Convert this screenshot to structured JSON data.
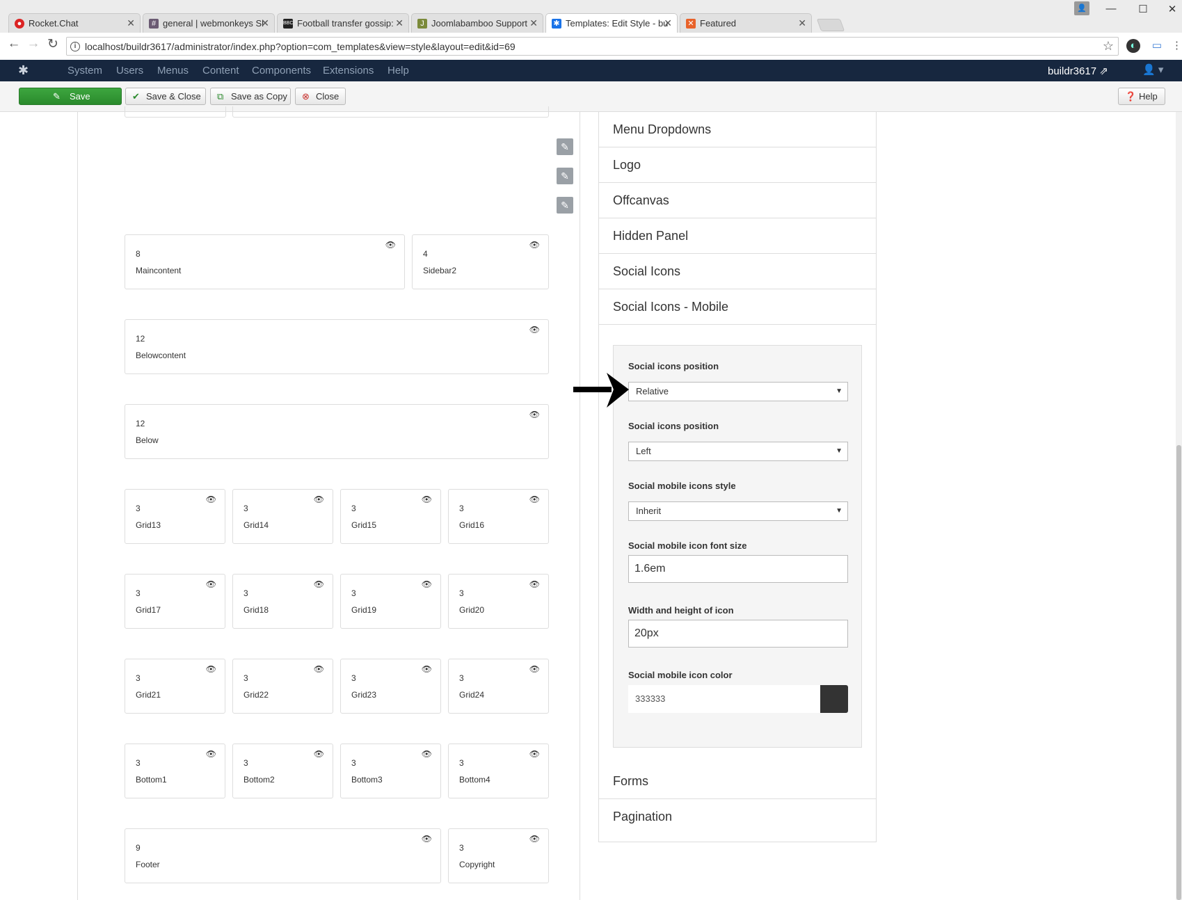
{
  "browser": {
    "tabs": [
      {
        "title": "Rocket.Chat",
        "fav": "rocketchat-icon",
        "color": "#db2323"
      },
      {
        "title": "general | webmonkeys Sl",
        "fav": "slack-hash-icon",
        "color": "#6b5b73"
      },
      {
        "title": "Football transfer gossip:",
        "fav": "bbc-icon",
        "color": "#222222"
      },
      {
        "title": "Joomlabamboo Support",
        "fav": "joomlabamboo-icon",
        "color": "#7b8a3a"
      },
      {
        "title": "Templates: Edit Style - bu",
        "fav": "joomla-icon",
        "color": "#1a73e8"
      },
      {
        "title": "Featured",
        "fav": "featured-icon",
        "color": "#e8622a"
      }
    ],
    "url": "localhost/buildr3617/administrator/index.php?option=com_templates&view=style&layout=edit&id=69"
  },
  "joomla": {
    "menu": [
      "System",
      "Users",
      "Menus",
      "Content",
      "Components",
      "Extensions",
      "Help"
    ],
    "site": "buildr3617",
    "toolbar": {
      "save": "Save",
      "save_close": "Save & Close",
      "save_copy": "Save as Copy",
      "close": "Close",
      "help": "Help"
    }
  },
  "layout_rows": [
    [
      {
        "n": "8",
        "name": "Maincontent"
      },
      {
        "n": "4",
        "name": "Sidebar2"
      }
    ],
    [
      {
        "n": "12",
        "name": "Belowcontent"
      }
    ],
    [
      {
        "n": "12",
        "name": "Below"
      }
    ],
    [
      {
        "n": "3",
        "name": "Grid13"
      },
      {
        "n": "3",
        "name": "Grid14"
      },
      {
        "n": "3",
        "name": "Grid15"
      },
      {
        "n": "3",
        "name": "Grid16"
      }
    ],
    [
      {
        "n": "3",
        "name": "Grid17"
      },
      {
        "n": "3",
        "name": "Grid18"
      },
      {
        "n": "3",
        "name": "Grid19"
      },
      {
        "n": "3",
        "name": "Grid20"
      }
    ],
    [
      {
        "n": "3",
        "name": "Grid21"
      },
      {
        "n": "3",
        "name": "Grid22"
      },
      {
        "n": "3",
        "name": "Grid23"
      },
      {
        "n": "3",
        "name": "Grid24"
      }
    ],
    [
      {
        "n": "3",
        "name": "Bottom1"
      },
      {
        "n": "3",
        "name": "Bottom2"
      },
      {
        "n": "3",
        "name": "Bottom3"
      },
      {
        "n": "3",
        "name": "Bottom4"
      }
    ],
    [
      {
        "n": "9",
        "name": "Footer"
      },
      {
        "n": "3",
        "name": "Copyright"
      }
    ]
  ],
  "accordion": {
    "items_top": [
      "Menu Dropdowns",
      "Logo",
      "Offcanvas",
      "Hidden Panel",
      "Social Icons",
      "Social Icons - Mobile"
    ],
    "items_bottom": [
      "Forms",
      "Pagination"
    ]
  },
  "panel": {
    "position_label": "Social icons position",
    "position_value": "Relative",
    "align_label": "Social icons position",
    "align_value": "Left",
    "style_label": "Social mobile icons style",
    "style_value": "Inherit",
    "fontsize_label": "Social mobile icon font size",
    "fontsize_value": "1.6em",
    "size_label": "Width and height of icon",
    "size_value": "20px",
    "color_label": "Social mobile icon color",
    "color_value": "333333"
  }
}
